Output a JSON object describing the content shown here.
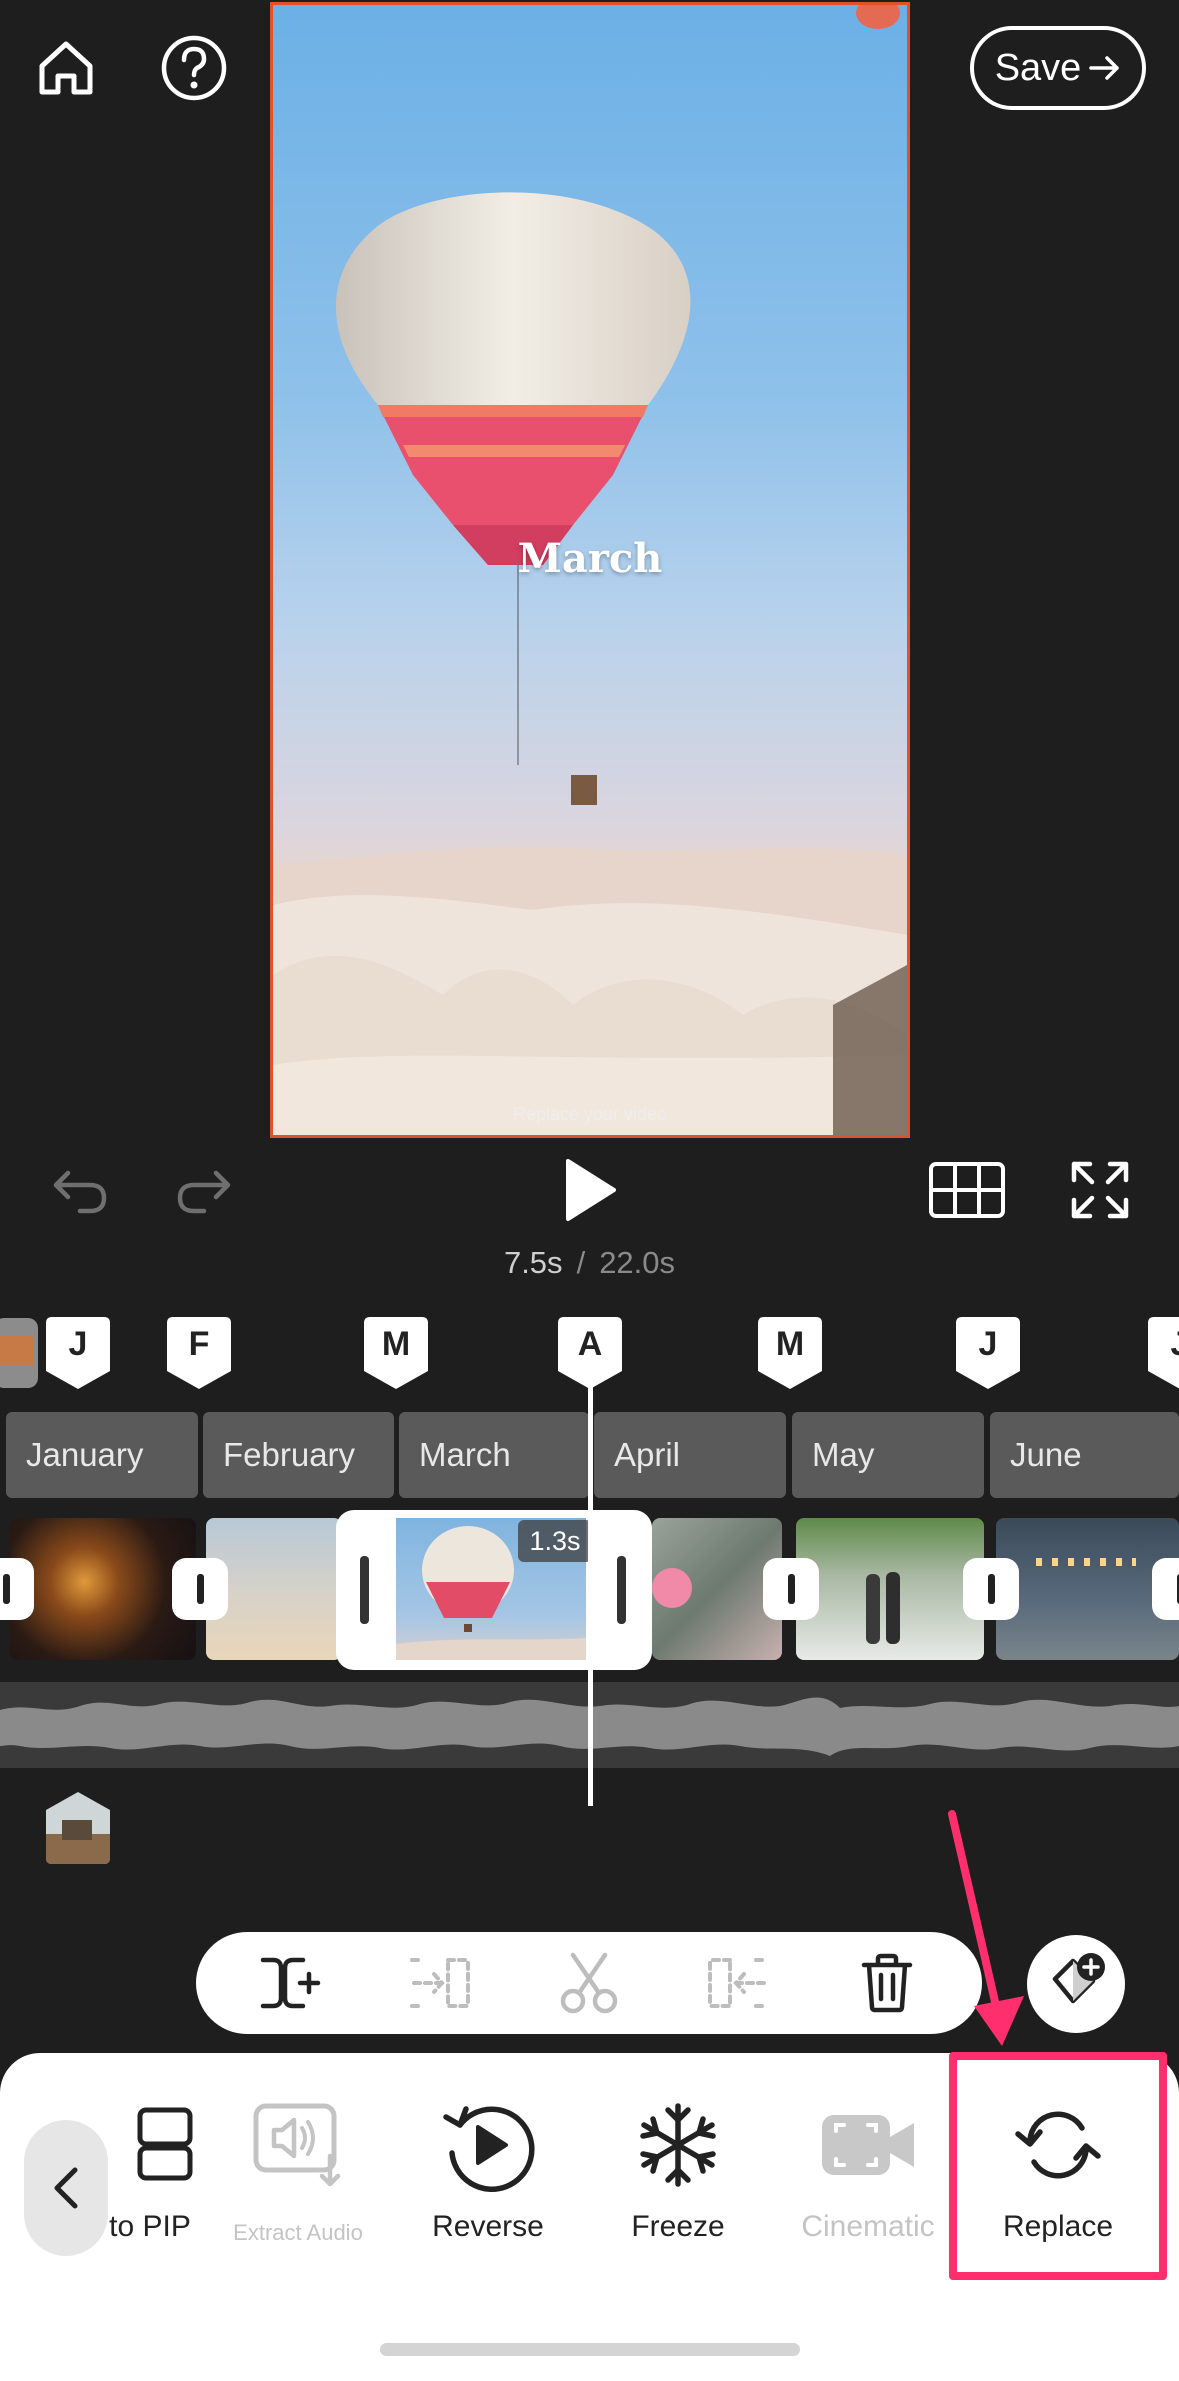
{
  "top_bar": {
    "home_icon": "home-icon",
    "help_icon": "question-circle-icon",
    "save_label": "Save"
  },
  "preview": {
    "title": "March",
    "caption": "Replace your video"
  },
  "playback": {
    "current_time": "7.5s",
    "separator": "/",
    "total_time": "22.0s"
  },
  "markers": [
    "J",
    "F",
    "M",
    "A",
    "M",
    "J",
    "J"
  ],
  "months": [
    "January",
    "February",
    "March",
    "April",
    "May",
    "June"
  ],
  "selected_clip": {
    "duration": "1.3s"
  },
  "bottom_tools": [
    {
      "label": "to PIP",
      "icon": "pip-icon",
      "enabled": true
    },
    {
      "label": "Extract Audio",
      "icon": "extract-audio-icon",
      "enabled": false
    },
    {
      "label": "Reverse",
      "icon": "reverse-icon",
      "enabled": true
    },
    {
      "label": "Freeze",
      "icon": "snowflake-icon",
      "enabled": true
    },
    {
      "label": "Cinematic",
      "icon": "cinematic-icon",
      "enabled": false
    },
    {
      "label": "Replace",
      "icon": "replace-icon",
      "enabled": true
    }
  ],
  "colors": {
    "background": "#1e1e1e",
    "preview_border": "#e2522a",
    "highlight": "#ff2f6e"
  }
}
